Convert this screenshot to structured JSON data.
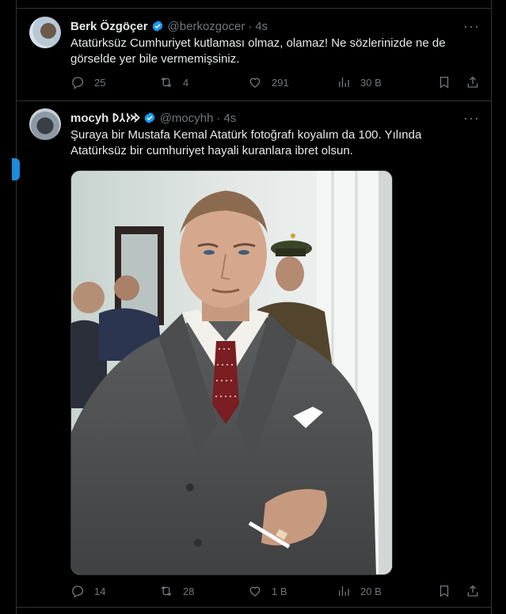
{
  "tweets": [
    {
      "name": "Berk Özgöçer",
      "handle": "@berkozgocer",
      "separator": "·",
      "time": "4s",
      "text": "Atatürksüz Cumhuriyet kutlaması olmaz, olamaz! Ne sözlerinizde ne de görselde yer bile vermemişsiniz.",
      "replies": "25",
      "retweets": "4",
      "likes": "291",
      "views": "30 B"
    },
    {
      "name": "mocyh 𐰢𐰆𐰲𐰖",
      "handle": "@mocyhh",
      "separator": "·",
      "time": "4s",
      "text": "Şuraya bir Mustafa Kemal Atatürk fotoğrafı koyalım da 100. Yılında Atatürksüz bir cumhuriyet hayali kuranlara ibret olsun.",
      "replies": "14",
      "retweets": "28",
      "likes": "1 B",
      "views": "20 B"
    }
  ],
  "colors": {
    "background": "#000000",
    "text": "#e7e9ea",
    "muted": "#71767b",
    "border": "#2f3336",
    "accent": "#1d9bf0"
  },
  "icons": [
    "verified-badge-icon",
    "more-icon",
    "reply-icon",
    "retweet-icon",
    "like-icon",
    "views-icon",
    "bookmark-icon",
    "share-icon"
  ]
}
